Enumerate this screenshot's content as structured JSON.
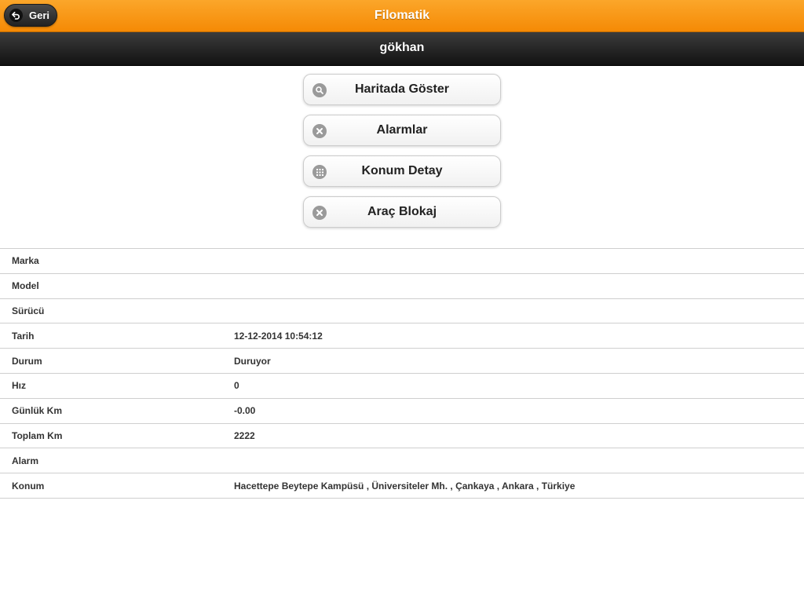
{
  "header": {
    "title": "Filomatik",
    "back_label": "Geri"
  },
  "subheader": {
    "title": "gökhan"
  },
  "actions": [
    {
      "label": "Haritada Göster",
      "icon": "search-icon"
    },
    {
      "label": "Alarmlar",
      "icon": "delete-icon"
    },
    {
      "label": "Konum Detay",
      "icon": "grid-icon"
    },
    {
      "label": "Araç Blokaj",
      "icon": "delete-icon"
    }
  ],
  "details": [
    {
      "label": "Marka",
      "value": ""
    },
    {
      "label": "Model",
      "value": ""
    },
    {
      "label": "Sürücü",
      "value": ""
    },
    {
      "label": "Tarih",
      "value": "12-12-2014 10:54:12"
    },
    {
      "label": "Durum",
      "value": "Duruyor"
    },
    {
      "label": "Hız",
      "value": "0"
    },
    {
      "label": "Günlük Km",
      "value": "-0.00"
    },
    {
      "label": "Toplam Km",
      "value": "2222"
    },
    {
      "label": "Alarm",
      "value": ""
    },
    {
      "label": "Konum",
      "value": "Hacettepe Beytepe Kampüsü , Üniversiteler Mh. , Çankaya , Ankara , Türkiye"
    }
  ],
  "colors": {
    "header_orange": "#f58a05",
    "subheader_dark": "#1e1e1e",
    "icon_gray": "#9a9a9a"
  }
}
